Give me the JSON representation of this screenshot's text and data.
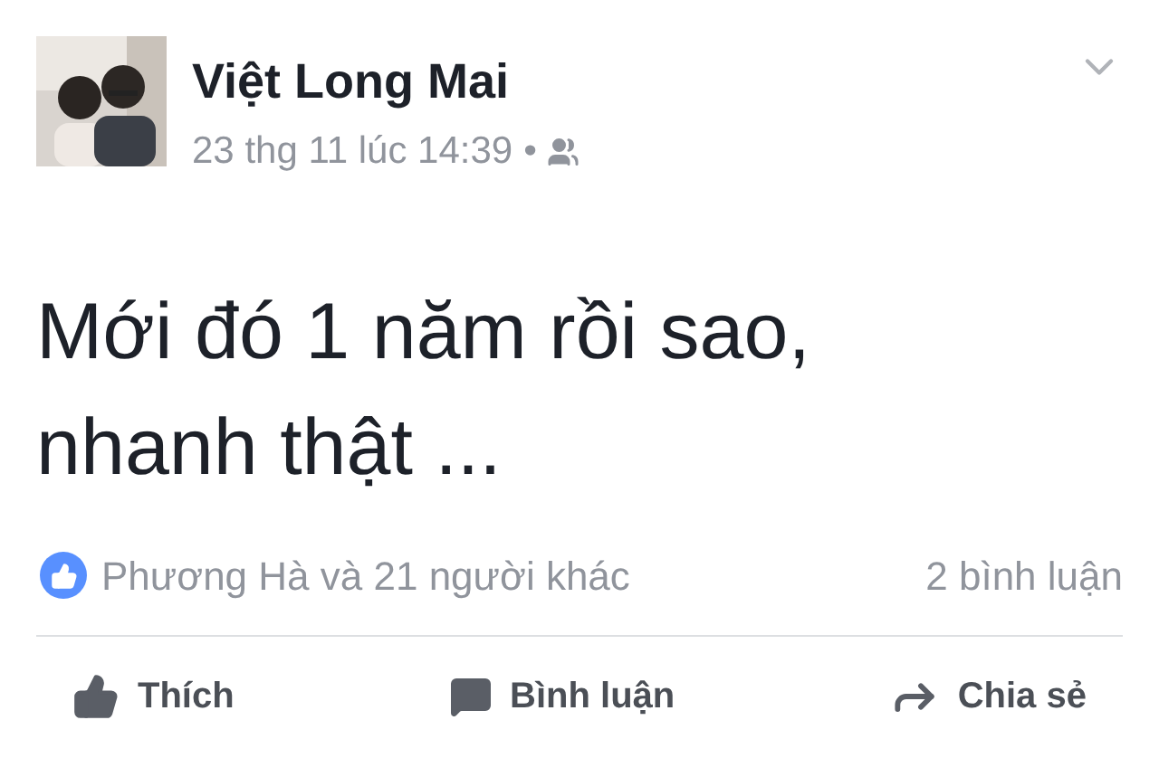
{
  "post": {
    "author": "Việt Long Mai",
    "timestamp": "23 thg 11 lúc 14:39",
    "separator": "•",
    "text": "Mới đó 1 năm rồi sao, nhanh thật ..."
  },
  "reactions": {
    "summary": "Phương Hà và 21 người khác",
    "comments": "2 bình luận"
  },
  "actions": [
    {
      "kind": "like",
      "label": "Thích"
    },
    {
      "kind": "comment",
      "label": "Bình luận"
    },
    {
      "kind": "share",
      "label": "Chia sẻ"
    }
  ]
}
